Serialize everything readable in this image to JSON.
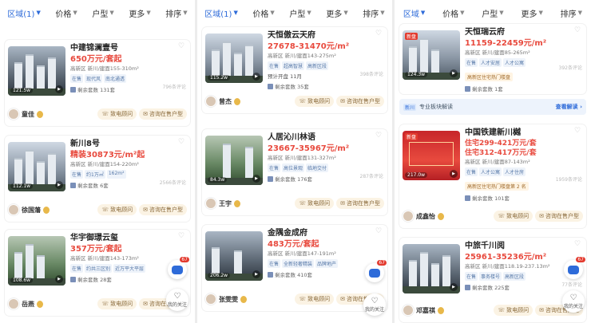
{
  "colors": {
    "accent": "#2e6bd9",
    "price": "#e84a3e",
    "button_bg": "#fbf3e4"
  },
  "filters": {
    "region": "区域(1)",
    "price": "价格",
    "layout": "户型",
    "more": "更多",
    "sort": "排序",
    "region_plain": "区域"
  },
  "common": {
    "remaining_prefix": "剩余套数",
    "call_btn": "致电顾问",
    "consult_btn": "咨询在售户型",
    "chat_badge": "67",
    "fav_label": "我的关注"
  },
  "col0": {
    "c1": {
      "name": "中建锦澜壹号",
      "price": "650万元/套起",
      "loc": "高新区 新川/建面155-310m²",
      "tags": [
        "在售",
        "现代风",
        "南北通透"
      ],
      "remain": "剩余套数 131套",
      "reviews": "796条评论",
      "views": "121.5w",
      "agent": "童佳"
    },
    "c2": {
      "name": "新川8号",
      "price": "精装30873元/m²起",
      "loc": "高新区 新川/建面154-220m²",
      "tags": [
        "在售",
        "约1万㎡",
        "162m²"
      ],
      "remain": "剩余套数 6套",
      "reviews": "2566条评论",
      "views": "112.1w",
      "agent": "徐国藩"
    },
    "c3": {
      "name": "华宇御璟云玺",
      "price": "357万元/套起",
      "loc": "高新区 新川/建面143-173m²",
      "tags": [
        "在售",
        "约共三区别",
        "近万平大平层"
      ],
      "remain": "剩余套数 28套",
      "reviews": "",
      "views": "108.6w",
      "agent": "岳燕"
    }
  },
  "col1": {
    "c1": {
      "name": "天恒傲云天府",
      "price": "27678-31470元/m²",
      "loc": "高新区 新川/建面143-275m²",
      "tags": [
        "在售",
        "超高智慧",
        "高新区段"
      ],
      "presale": "预计开盘 11月",
      "remain": "剩余套数 35套",
      "reviews": "398条评论",
      "views": "115.2w",
      "agent": "曾杰"
    },
    "c2": {
      "name": "人居沁川林语",
      "price": "23667-35967元/m²",
      "loc": "高新区 新川/建面131-327m²",
      "tags": [
        "在售",
        "高位景观",
        "临地交付"
      ],
      "remain": "剩余套数 176套",
      "reviews": "287条评论",
      "views": "84.3w",
      "agent": "王宇"
    },
    "c3": {
      "name": "金隅金成府",
      "price": "483万元/套起",
      "loc": "高新区 新川/建面147-191m²",
      "tags": [
        "在售",
        "全新轻奢精装",
        "品牌地产"
      ],
      "remain": "剩余套数 410套",
      "reviews": "",
      "views": "206.2w",
      "agent": "张雯雯"
    }
  },
  "col2": {
    "c1": {
      "name": "天恒瑞云府",
      "price": "11159-22459元/m²",
      "loc": "高新区 新川/建面85-265m²",
      "tags": [
        "在售",
        "人才安居",
        "人才公寓"
      ],
      "rank": "高新区住宅热门楼盘",
      "remain": "剩余套数 1套",
      "reviews": "392条评论",
      "views": "124.3w",
      "hot": "新盘"
    },
    "banner": {
      "badge": "新川",
      "text": "专业板块解读",
      "link": "查看解读 ›"
    },
    "c2": {
      "name": "中国铁建新川樾",
      "price": "住宅299-421万元/套",
      "price2": "住宅312-417万元/套",
      "loc": "高新区 新川/建面87-143m²",
      "tags": [
        "在售",
        "人才公寓",
        "人才住房"
      ],
      "rank": "高新区住宅热门楼盘第 2 名",
      "remain": "剩余套数 101套",
      "reviews": "1959条评论",
      "views": "217.0w",
      "agent": "成鑫怡",
      "hot": "新盘"
    },
    "c3": {
      "name": "中旅千川阅",
      "price": "25961-35236元/m²",
      "loc": "高新区 新川/建面118.19-237.13m²",
      "tags": [
        "在售",
        "事务楼号",
        "高新区段"
      ],
      "remain": "剩余套数 225套",
      "reviews": "77条评论",
      "views": "",
      "agent": "邓嘉祺"
    }
  }
}
